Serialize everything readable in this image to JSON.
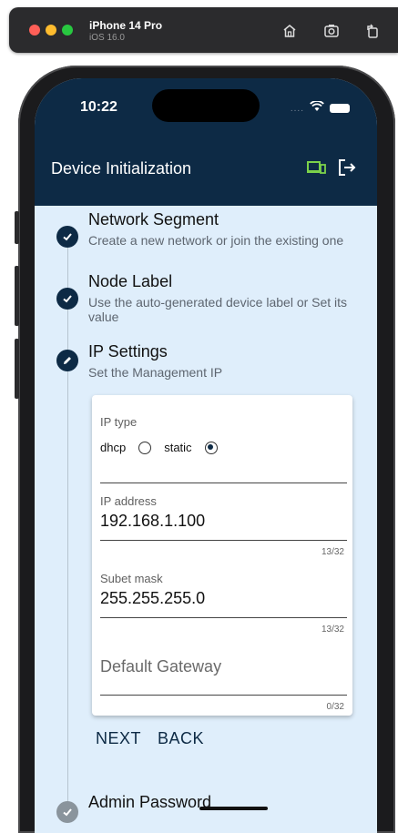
{
  "simulator": {
    "device_name": "iPhone 14 Pro",
    "os_version": "iOS 16.0",
    "icons": [
      "home-icon",
      "screenshot-icon",
      "rotate-icon"
    ]
  },
  "status_bar": {
    "time": "10:22",
    "signal_dots": "....",
    "icons": [
      "wifi-icon",
      "battery-icon"
    ]
  },
  "header": {
    "title": "Device Initialization",
    "icons": [
      "devices-icon",
      "logout-icon"
    ],
    "background": "#0d2a45",
    "devices_icon_color": "#7bd14a"
  },
  "steps": [
    {
      "title": "Network Segment",
      "description": "Create a new network or join the existing one",
      "state": "done",
      "icon": "check-icon"
    },
    {
      "title": "Node Label",
      "description": "Use the auto-generated device label or Set its value",
      "state": "done",
      "icon": "check-icon"
    },
    {
      "title": "IP Settings",
      "description": "Set the Management IP",
      "state": "editing",
      "icon": "pencil-icon"
    },
    {
      "title": "Admin Password",
      "state": "done",
      "icon": "check-icon"
    }
  ],
  "ip_form": {
    "ip_type_label": "IP type",
    "options": [
      "dhcp",
      "static"
    ],
    "selected_option": "static",
    "ip_address": {
      "label": "IP address",
      "value": "192.168.1.100",
      "counter": "13/32"
    },
    "subnet_mask": {
      "label": "Subet mask",
      "value": "255.255.255.0",
      "counter": "13/32"
    },
    "default_gateway": {
      "placeholder": "Default Gateway",
      "value": "",
      "counter": "0/32"
    }
  },
  "actions": {
    "next": "NEXT",
    "back": "BACK"
  },
  "colors": {
    "screen_bg": "#dfeefb",
    "primary": "#0d2a45"
  }
}
